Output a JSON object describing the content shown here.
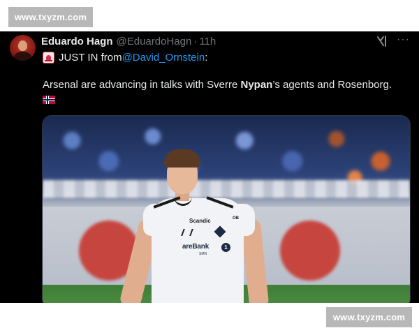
{
  "watermark": {
    "text": "www.txyzm.com"
  },
  "tweet": {
    "display_name": "Eduardo Hagn",
    "handle": "@EduardoHagn",
    "separator": "·",
    "time": "11h",
    "more_label": "···",
    "line1": {
      "prefix": "JUST IN from ",
      "mention": "@David_Ornstein",
      "suffix": ":"
    },
    "body": {
      "before": "Arsenal are advancing in talks with Sverre ",
      "bold": "Nypan",
      "after": "’s agents and Rosenborg."
    },
    "media": {
      "sponsor_top": "Scandic",
      "sponsor_main": "areBank",
      "sponsor_sub": "SMN",
      "sponsor_num": "1",
      "sleeve_text": "OB"
    },
    "icons": {
      "siren": "siren-emoji-icon",
      "flag": "norway-flag-icon",
      "grok": "grok-icon",
      "more": "more-options-icon"
    }
  }
}
